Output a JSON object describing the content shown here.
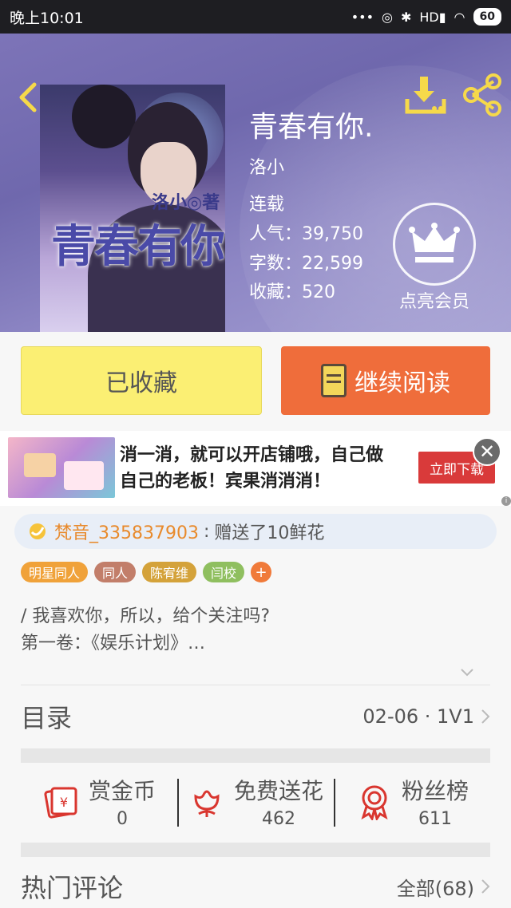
{
  "status_bar": {
    "time": "晚上10:01",
    "signal_label": "HD",
    "battery": "60"
  },
  "book": {
    "title": "青春有你.",
    "author": "洛小",
    "status": "连载",
    "popularity_label": "人气：",
    "popularity": "39,750",
    "words_label": "字数：",
    "words": "22,599",
    "favorites_label": "收藏：",
    "favorites": "520",
    "cover": {
      "title_art": "青春有你",
      "author_mark": "洛小◎著"
    }
  },
  "vip": {
    "label": "点亮会员"
  },
  "actions": {
    "favorited_label": "已收藏",
    "continue_label": "继续阅读"
  },
  "ad": {
    "text": "消一消，就可以开店铺哦，自己做自己的老板！宾果消消消！",
    "button": "立即下载",
    "close": "✕",
    "badge": "i"
  },
  "gift": {
    "user": "梵音_335837903",
    "colon": ":",
    "message": "赠送了10鲜花"
  },
  "tags": [
    "明星同人",
    "同人",
    "陈宥维",
    "闫校",
    "+"
  ],
  "description": {
    "line1": "/  我喜欢你，所以，给个关注吗?",
    "line2": "第一卷：《娱乐计划》…"
  },
  "toc": {
    "label": "目录",
    "latest": "02-06 · 1V1"
  },
  "stats": [
    {
      "label": "赏金币",
      "value": "0"
    },
    {
      "label": "免费送花",
      "value": "462"
    },
    {
      "label": "粉丝榜",
      "value": "611"
    }
  ],
  "comments": {
    "label": "热门评论",
    "all": "全部(68)"
  },
  "colors": {
    "hero_purple": "#7d74b8",
    "favorite_yellow": "#fbef73",
    "read_orange": "#ef6d3b",
    "icon_yellow": "#f6d94a",
    "stat_red": "#d9362f"
  },
  "icons": {
    "back": "chevron-left-icon",
    "download": "download-icon",
    "share": "share-icon",
    "vip": "crown-icon",
    "book": "book-icon",
    "gift": "flower-icon",
    "reward": "red-envelope-icon",
    "flower": "flower-icon",
    "fans": "medal-icon"
  }
}
